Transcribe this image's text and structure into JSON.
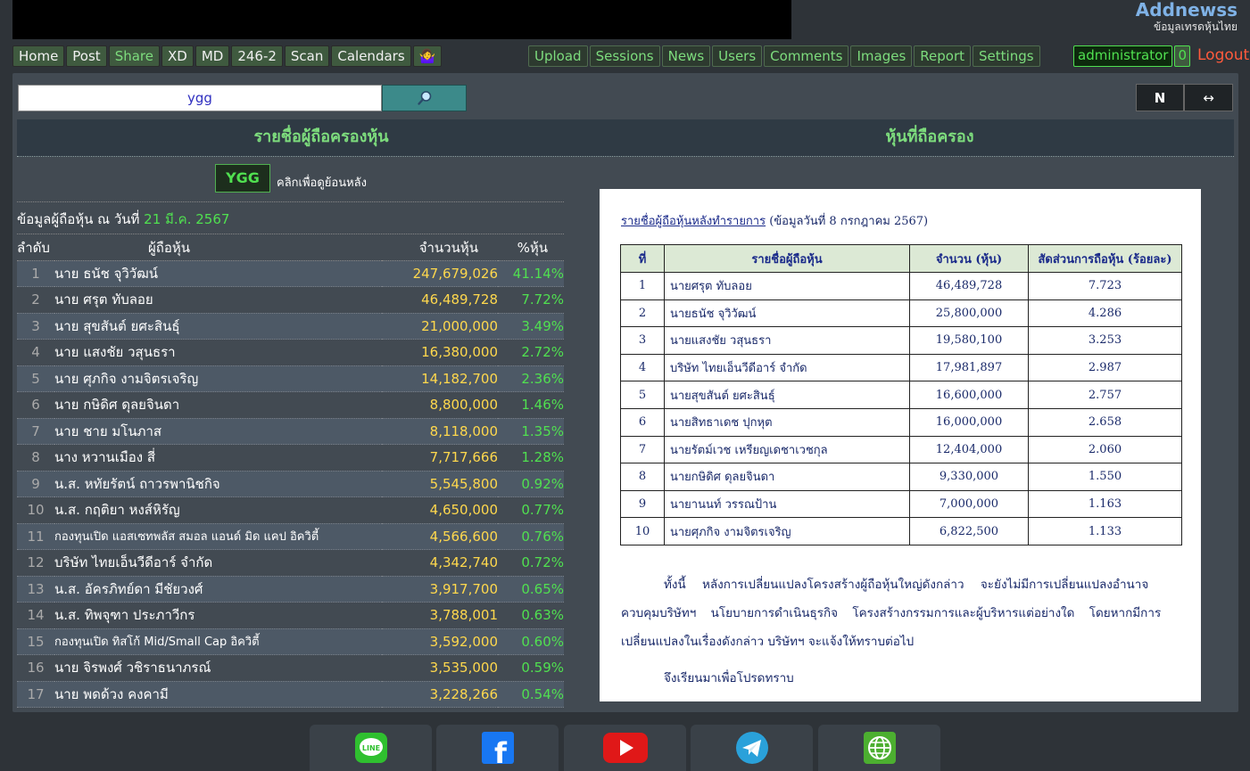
{
  "brand": {
    "name": "Addnewss",
    "subtitle": "ข้อมูลเทรดหุ้นไทย"
  },
  "nav_left": [
    {
      "label": "Home",
      "active": false
    },
    {
      "label": "Post",
      "active": false
    },
    {
      "label": "Share",
      "active": true
    },
    {
      "label": "XD",
      "active": false
    },
    {
      "label": "MD",
      "active": false
    },
    {
      "label": "246-2",
      "active": false
    },
    {
      "label": "Scan",
      "active": false
    },
    {
      "label": "Calendars",
      "active": false
    },
    {
      "label": "🤷‍♀️",
      "active": false
    }
  ],
  "nav_mid": [
    "Upload",
    "Sessions",
    "News",
    "Users",
    "Comments",
    "Images",
    "Report",
    "Settings"
  ],
  "user": {
    "name": "administrator",
    "count": "0",
    "logout": "Logout"
  },
  "search": {
    "value": "ygg"
  },
  "tools": {
    "n_label": "N",
    "swap_label": "↔"
  },
  "headers": {
    "left": "รายชื่อผู้ถือครองหุ้น",
    "right": "หุ้นที่ถือครอง"
  },
  "symbol": {
    "label": "YGG",
    "hint": "คลิกเพื่อดูย้อนหลัง"
  },
  "info": {
    "prefix": "ข้อมูลผู้ถือหุ้น ณ วันที่",
    "date": "21 มี.ค. 2567"
  },
  "table_headers": {
    "rank": "ลำดับ",
    "holder": "ผู้ถือหุ้น",
    "shares": "จำนวนหุ้น",
    "pct": "%หุ้น"
  },
  "holders": [
    {
      "rank": "1",
      "name": "นาย ธนัช จุวิวัฒน์",
      "shares": "247,679,026",
      "pct": "41.14%"
    },
    {
      "rank": "2",
      "name": "นาย ศรุต ทับลอย",
      "shares": "46,489,728",
      "pct": "7.72%"
    },
    {
      "rank": "3",
      "name": "นาย สุขสันต์ ยศะสินธุ์",
      "shares": "21,000,000",
      "pct": "3.49%"
    },
    {
      "rank": "4",
      "name": "นาย แสงชัย วสุนธรา",
      "shares": "16,380,000",
      "pct": "2.72%"
    },
    {
      "rank": "5",
      "name": "นาย ศุภกิจ งามจิตรเจริญ",
      "shares": "14,182,700",
      "pct": "2.36%"
    },
    {
      "rank": "6",
      "name": "นาย กษิดิศ ดุลยจินดา",
      "shares": "8,800,000",
      "pct": "1.46%"
    },
    {
      "rank": "7",
      "name": "นาย ชาย มโนภาส",
      "shares": "8,118,000",
      "pct": "1.35%"
    },
    {
      "rank": "8",
      "name": "นาง หวานเมือง สี่",
      "shares": "7,717,666",
      "pct": "1.28%"
    },
    {
      "rank": "9",
      "name": "น.ส. หทัยรัตน์ ถาวรพานิชกิจ",
      "shares": "5,545,800",
      "pct": "0.92%"
    },
    {
      "rank": "10",
      "name": "น.ส. กฤติยา หงส์หิรัญ",
      "shares": "4,650,000",
      "pct": "0.77%"
    },
    {
      "rank": "11",
      "name": "กองทุนเปิด แอสเซทพลัส สมอล แอนด์ มิด แคป อิควิตี้",
      "shares": "4,566,600",
      "pct": "0.76%"
    },
    {
      "rank": "12",
      "name": "บริษัท ไทยเอ็นวีดีอาร์ จำกัด",
      "shares": "4,342,740",
      "pct": "0.72%"
    },
    {
      "rank": "13",
      "name": "น.ส. อัครภิทย์ดา มีชัยวงศ์",
      "shares": "3,917,700",
      "pct": "0.65%"
    },
    {
      "rank": "14",
      "name": "น.ส. ทิพจุฑา ประภาวีกร",
      "shares": "3,788,001",
      "pct": "0.63%"
    },
    {
      "rank": "15",
      "name": "กองทุนเปิด ทิสโก้ Mid/Small Cap อิควิตี้",
      "shares": "3,592,000",
      "pct": "0.60%"
    },
    {
      "rank": "16",
      "name": "นาย จิรพงศ์ วชิราธนาภรณ์",
      "shares": "3,535,000",
      "pct": "0.59%"
    },
    {
      "rank": "17",
      "name": "นาย พดด้วง คงคามี",
      "shares": "3,228,266",
      "pct": "0.54%"
    }
  ],
  "document": {
    "title_link": "รายชื่อผู้ถือหุ้นหลังทำรายการ",
    "title_rest": " (ข้อมูลวันที่ 8 กรกฎาคม 2567)",
    "headers": [
      "ที่",
      "รายชื่อผู้ถือหุ้น",
      "จำนวน (หุ้น)",
      "สัดส่วนการถือหุ้น (ร้อยละ)"
    ],
    "rows": [
      [
        "1",
        "นายศรุต ทับลอย",
        "46,489,728",
        "7.723"
      ],
      [
        "2",
        "นายธนัช จุวิวัฒน์",
        "25,800,000",
        "4.286"
      ],
      [
        "3",
        "นายแสงชัย วสุนธรา",
        "19,580,100",
        "3.253"
      ],
      [
        "4",
        "บริษัท ไทยเอ็นวีดีอาร์ จำกัด",
        "17,981,897",
        "2.987"
      ],
      [
        "5",
        "นายสุขสันต์ ยศะสินธุ์",
        "16,600,000",
        "2.757"
      ],
      [
        "6",
        "นายสิทธาเดช ปุกหุต",
        "16,000,000",
        "2.658"
      ],
      [
        "7",
        "นายรัตม์เวช เหรียญเดชาเวชกุล",
        "12,404,000",
        "2.060"
      ],
      [
        "8",
        "นายกษิดิศ ดุลยจินดา",
        "9,330,000",
        "1.550"
      ],
      [
        "9",
        "นายานนท์ วรรณป้าน",
        "7,000,000",
        "1.163"
      ],
      [
        "10",
        "นายศุภกิจ งามจิตรเจริญ",
        "6,822,500",
        "1.133"
      ]
    ],
    "para1": "ทั้งนี้ หลังการเปลี่ยนแปลงโครงสร้างผู้ถือหุ้นใหญ่ดังกล่าว จะยังไม่มีการเปลี่ยนแปลงอำนาจ",
    "para2": "ควบคุมบริษัทฯ นโยบายการดำเนินธุรกิจ โครงสร้างกรรมการและผู้บริหารแต่อย่างใด โดยหากมีการ",
    "para3": "เปลี่ยนแปลงในเรื่องดังกล่าว บริษัทฯ จะแจ้งให้ทราบต่อไป",
    "para4": "จึงเรียนมาเพื่อโปรดทราบ"
  },
  "footer": [
    {
      "icon": "line-icon",
      "color": "#2fc02f"
    },
    {
      "icon": "facebook-icon",
      "color": "#1877f2"
    },
    {
      "icon": "youtube-icon",
      "color": "#e01818"
    },
    {
      "icon": "telegram-icon",
      "color": "#2aa1da"
    },
    {
      "icon": "web-icon",
      "color": "#4caf30"
    }
  ]
}
